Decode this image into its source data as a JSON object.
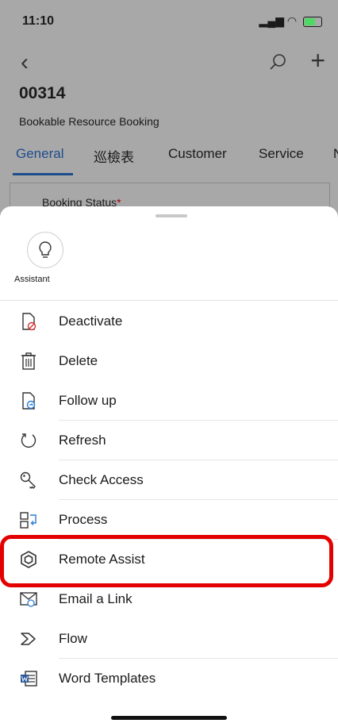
{
  "status_bar": {
    "time": "11:10",
    "signal": "▂▄▆ ◠"
  },
  "record": {
    "title": "00314",
    "subtitle": "Bookable Resource Booking"
  },
  "tabs": [
    {
      "label": "General"
    },
    {
      "label": "巡檢表"
    },
    {
      "label": "Customer"
    },
    {
      "label": "Service"
    },
    {
      "label": "N"
    }
  ],
  "form": {
    "booking_status_label": "Booking Status",
    "required_mark": "*"
  },
  "sheet": {
    "assistant_label": "Assistant",
    "menu_items": [
      {
        "label": "Deactivate",
        "icon": "deactivate-icon"
      },
      {
        "label": "Delete",
        "icon": "delete-icon"
      },
      {
        "label": "Follow up",
        "icon": "follow-up-icon"
      },
      {
        "label": "Refresh",
        "icon": "refresh-icon"
      },
      {
        "label": "Check Access",
        "icon": "key-icon"
      },
      {
        "label": "Process",
        "icon": "process-icon"
      },
      {
        "label": "Remote Assist",
        "icon": "remote-assist-icon"
      },
      {
        "label": "Email a Link",
        "icon": "email-link-icon"
      },
      {
        "label": "Flow",
        "icon": "flow-icon"
      },
      {
        "label": "Word Templates",
        "icon": "word-templates-icon"
      }
    ]
  },
  "colors": {
    "accent": "#1e4d8c",
    "highlight": "#e30000",
    "overlay": "#a8a8a8"
  }
}
